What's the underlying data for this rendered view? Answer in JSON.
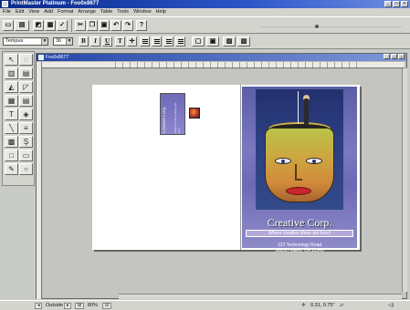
{
  "window": {
    "title": "PrintMaster Platinum - Foo0x8677",
    "minimize": "_",
    "maximize": "□",
    "close": "×"
  },
  "menu": [
    "File",
    "Edit",
    "View",
    "Add",
    "Format",
    "Arrange",
    "Table",
    "Tools",
    "Window",
    "Help"
  ],
  "toolbar": {
    "help_label": "?"
  },
  "format_bar": {
    "font_value": "Tempus",
    "size_value": "36",
    "bold": "B",
    "italic": "I",
    "underline": "U"
  },
  "document": {
    "title": "Foo0x8677"
  },
  "project": {
    "card_title": "Creative Corp.",
    "card_subtitle": "Where creative ideas are born",
    "cover_title": "Creative Corp.",
    "cover_tagline": "Where creative ideas are born!",
    "address_line1": "123 Technology Road",
    "address_line2": "Silicon Valley, CA 12345"
  },
  "status": {
    "page_label": "Outside",
    "zoom": "80%",
    "coords": "0.31, 0.75\""
  },
  "colors": {
    "title_bar": "#0a2a8a",
    "cover_bg": "#6c69b5",
    "face": "#cda640",
    "lips": "#c8262a"
  },
  "icons": [
    "new-icon",
    "open-icon",
    "save-icon",
    "print-icon",
    "cut-icon",
    "copy-icon",
    "paste-icon",
    "undo-icon",
    "redo-icon",
    "help-icon"
  ]
}
